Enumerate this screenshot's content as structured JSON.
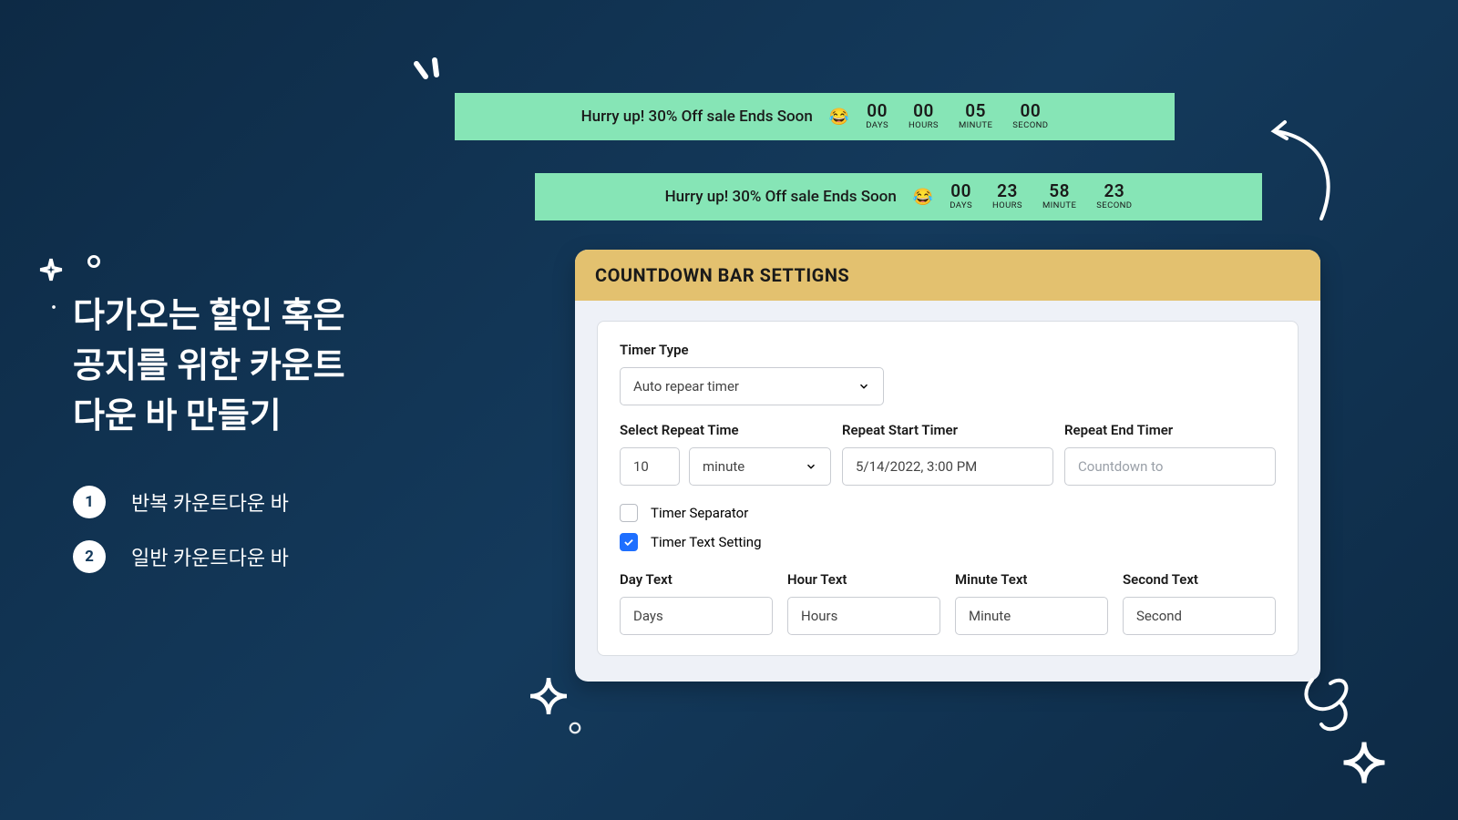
{
  "countdown_bars": [
    {
      "message": "Hurry up! 30% Off sale Ends Soon",
      "emoji": "😂",
      "units": [
        {
          "value": "00",
          "label": "DAYS"
        },
        {
          "value": "00",
          "label": "HOURS"
        },
        {
          "value": "05",
          "label": "MINUTE"
        },
        {
          "value": "00",
          "label": "SECOND"
        }
      ]
    },
    {
      "message": "Hurry up! 30% Off sale Ends Soon",
      "emoji": "😂",
      "units": [
        {
          "value": "00",
          "label": "DAYS"
        },
        {
          "value": "23",
          "label": "HOURS"
        },
        {
          "value": "58",
          "label": "MINUTE"
        },
        {
          "value": "23",
          "label": "SECOND"
        }
      ]
    }
  ],
  "headline": {
    "line1": "다가오는 할인 혹은",
    "line2": "공지를 위한 카운트",
    "line3": "다운 바 만들기"
  },
  "bullets": [
    {
      "num": "1",
      "text": "반복 카운트다운 바"
    },
    {
      "num": "2",
      "text": "일반 카운트다운 바"
    }
  ],
  "panel": {
    "title": "COUNTDOWN BAR SETTIGNS",
    "timer_type": {
      "label": "Timer Type",
      "value": "Auto repear timer"
    },
    "repeat_time": {
      "label": "Select Repeat Time",
      "value": "10",
      "unit": "minute"
    },
    "repeat_start": {
      "label": "Repeat Start Timer",
      "value": "5/14/2022, 3:00 PM"
    },
    "repeat_end": {
      "label": "Repeat End Timer",
      "placeholder": "Countdown to"
    },
    "timer_separator": {
      "label": "Timer Separator"
    },
    "timer_text_setting": {
      "label": "Timer Text Setting"
    },
    "day_text": {
      "label": "Day Text",
      "value": "Days"
    },
    "hour_text": {
      "label": "Hour Text",
      "value": "Hours"
    },
    "minute_text": {
      "label": "Minute Text",
      "value": "Minute"
    },
    "second_text": {
      "label": "Second Text",
      "value": "Second"
    }
  }
}
